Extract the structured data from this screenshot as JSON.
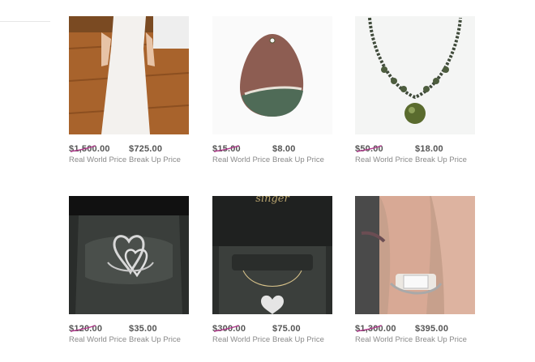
{
  "colors": {
    "strike": "#b0368a",
    "price": "#555555",
    "label": "#8a8a8a"
  },
  "products": [
    {
      "name": "wedding-dress",
      "real_price": "$1,500.00",
      "break_price": "$725.00",
      "real_label": "Real World Price",
      "break_label": "Break Up Price"
    },
    {
      "name": "jasper-pendant",
      "real_price": "$15.00",
      "break_price": "$8.00",
      "real_label": "Real World Price",
      "break_label": "Break Up Price"
    },
    {
      "name": "beaded-necklace",
      "real_price": "$50.00",
      "break_price": "$18.00",
      "real_label": "Real World Price",
      "break_label": "Break Up Price"
    },
    {
      "name": "heart-ring",
      "real_price": "$120.00",
      "break_price": "$35.00",
      "real_label": "Real World Price",
      "break_label": "Break Up Price"
    },
    {
      "name": "heart-necklace-box",
      "real_price": "$300.00",
      "break_price": "$75.00",
      "real_label": "Real World Price",
      "break_label": "Break Up Price",
      "box_text": "singer"
    },
    {
      "name": "engagement-ring",
      "real_price": "$1,300.00",
      "break_price": "$395.00",
      "real_label": "Real World Price",
      "break_label": "Break Up Price"
    }
  ]
}
